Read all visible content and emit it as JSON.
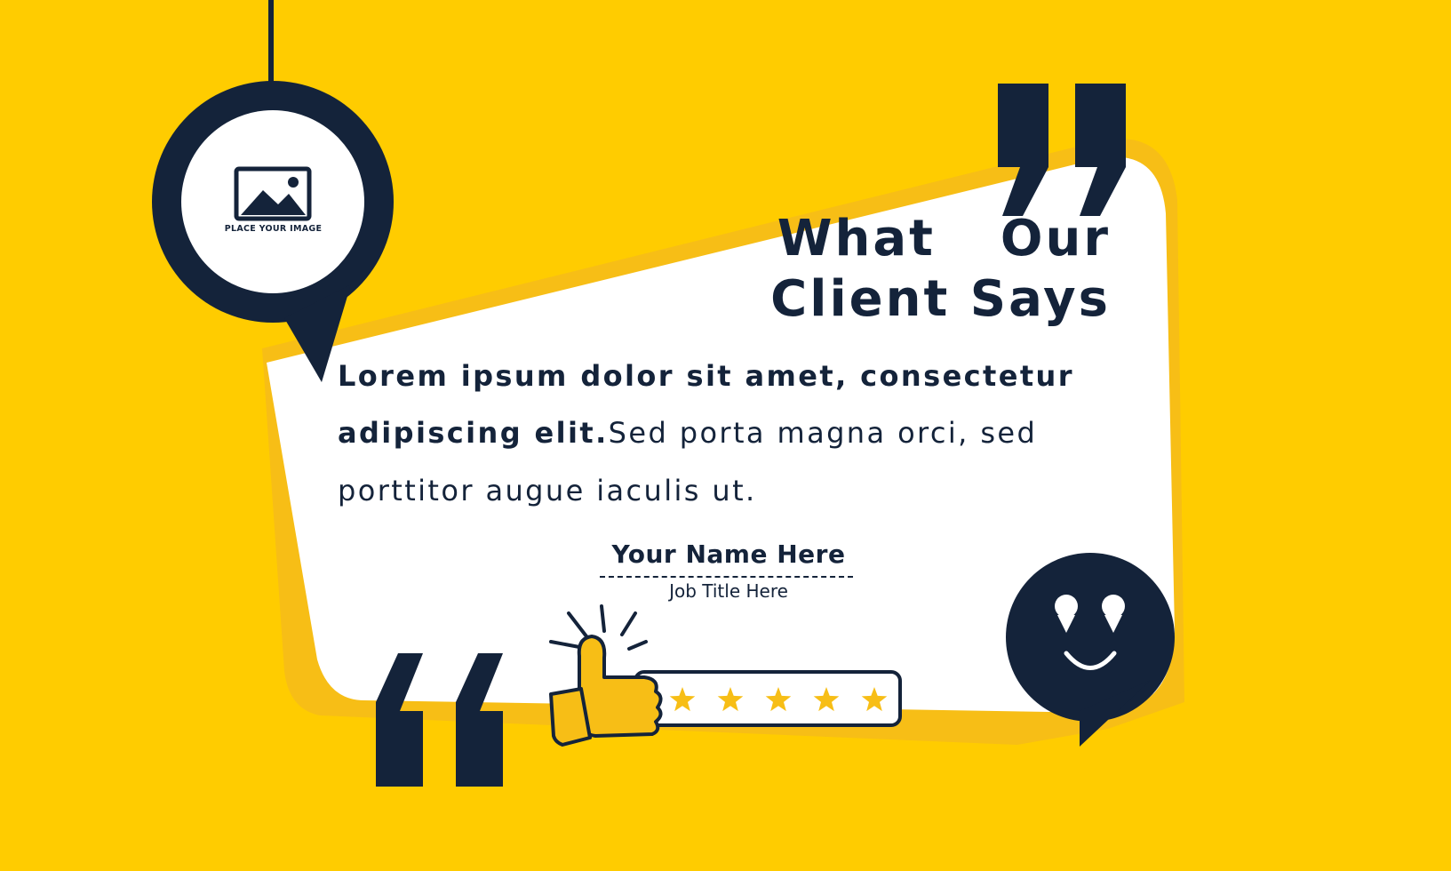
{
  "colors": {
    "background": "#FFCC00",
    "accent_yellow": "#F7BE16",
    "navy": "#14233A",
    "card": "#FFFFFF"
  },
  "avatar": {
    "placeholder_label": "PLACE YOUR IMAGE",
    "icon": "image-icon"
  },
  "heading": {
    "line1": "What  Our",
    "line2": "Client Says"
  },
  "quote": {
    "line1": "Lorem ipsum dolor sit amet, consectetur",
    "line2_bold": "adipiscing elit.",
    "line2_rest": "Sed porta magna orci, sed",
    "line3": "porttitor augue iaculis ut."
  },
  "author": {
    "name": "Your Name Here",
    "job_title": "Job Title Here"
  },
  "rating": {
    "stars": 5,
    "max": 5,
    "icon": "thumbs-up-icon"
  },
  "decor": {
    "open_quote_icon": "quote-open-icon",
    "close_quote_icon": "quote-close-icon",
    "smiley_icon": "smiley-chat-icon"
  }
}
